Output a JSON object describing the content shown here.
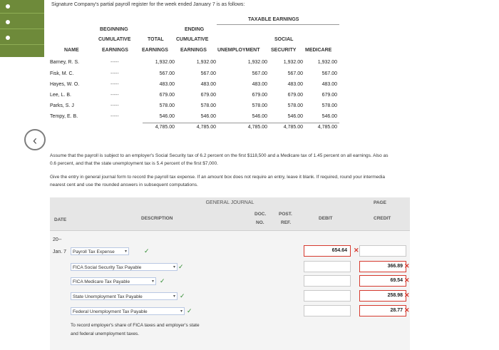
{
  "intro": "Signature Company's partial payroll register for the week ended January 7 is as follows:",
  "register": {
    "super_header": "TAXABLE EARNINGS",
    "headers": {
      "name": "NAME",
      "beginning": [
        "BEGINNING",
        "CUMULATIVE",
        "EARNINGS"
      ],
      "total": [
        "TOTAL",
        "EARNINGS"
      ],
      "ending": [
        "ENDING",
        "CUMULATIVE",
        "EARNINGS"
      ],
      "unemployment": "UNEMPLOYMENT",
      "social_security": [
        "SOCIAL",
        "SECURITY"
      ],
      "medicare": "MEDICARE"
    },
    "rows": [
      {
        "name": "Barney, R. S.",
        "beginning": "-----",
        "total": "1,932.00",
        "ending": "1,932.00",
        "unemployment": "1,932.00",
        "social_security": "1,932.00",
        "medicare": "1,932.00"
      },
      {
        "name": "Fisk, M. C.",
        "beginning": "-----",
        "total": "567.00",
        "ending": "567.00",
        "unemployment": "567.00",
        "social_security": "567.00",
        "medicare": "567.00"
      },
      {
        "name": "Hayes, W. O.",
        "beginning": "-----",
        "total": "483.00",
        "ending": "483.00",
        "unemployment": "483.00",
        "social_security": "483.00",
        "medicare": "483.00"
      },
      {
        "name": "Lee, L. B.",
        "beginning": "-----",
        "total": "679.00",
        "ending": "679.00",
        "unemployment": "679.00",
        "social_security": "679.00",
        "medicare": "679.00"
      },
      {
        "name": "Parks, S. J",
        "beginning": "-----",
        "total": "578.00",
        "ending": "578.00",
        "unemployment": "578.00",
        "social_security": "578.00",
        "medicare": "578.00"
      },
      {
        "name": "Tempy, E. B.",
        "beginning": "-----",
        "total": "546.00",
        "ending": "546.00",
        "unemployment": "546.00",
        "social_security": "546.00",
        "medicare": "546.00"
      }
    ],
    "totals": {
      "total": "4,785.00",
      "ending": "4,785.00",
      "unemployment": "4,785.00",
      "social_security": "4,785.00",
      "medicare": "4,785.00"
    }
  },
  "paragraph1_line1": "Assume that the payroll is subject to an employer's Social Security tax of 6.2 percent on the first $118,500 and a Medicare tax of 1.45 percent on all earnings. Also as",
  "paragraph1_line2": "0.6 percent, and that the state unemployment tax is 5.4 percent of the first $7,000.",
  "paragraph2_line1": "Give the entry in general journal form to record the payroll tax expense. If an amount box does not require an entry, leave it blank. If required, round your intermedia",
  "paragraph2_line2": "nearest cent and use the rounded answers in subsequent computations.",
  "journal": {
    "title": "GENERAL JOURNAL",
    "page_label": "PAGE",
    "columns": {
      "date": "DATE",
      "description": "DESCRIPTION",
      "doc_no": [
        "DOC.",
        "NO."
      ],
      "post_ref": [
        "POST.",
        "REF."
      ],
      "debit": "DEBIT",
      "credit": "CREDIT"
    },
    "year": "20--",
    "date": "Jan. 7",
    "entries": [
      {
        "account": "Payroll Tax Expense",
        "debit": "654.64",
        "credit": "",
        "status": "correct"
      },
      {
        "account": "FICA Social Security Tax Payable",
        "debit": "",
        "credit": "366.89",
        "status": "correct"
      },
      {
        "account": "FICA Medicare Tax Payable",
        "debit": "",
        "credit": "69.54",
        "status": "correct"
      },
      {
        "account": "State Unemployment Tax Payable",
        "debit": "",
        "credit": "258.98",
        "status": "correct"
      },
      {
        "account": "Federal Unemployment Tax Payable",
        "debit": "",
        "credit": "28.77",
        "status": "correct"
      }
    ],
    "explanation_line1": "To record employer's share of FICA taxes and employer's state",
    "explanation_line2": "and federal unemployment taxes."
  },
  "icons": {
    "check": "✓",
    "cross": "✕",
    "caret": "▾",
    "back": "‹"
  },
  "colors": {
    "check": "#2e8b2e",
    "cross": "#d63a2f",
    "strip": "#6e8a3a"
  }
}
